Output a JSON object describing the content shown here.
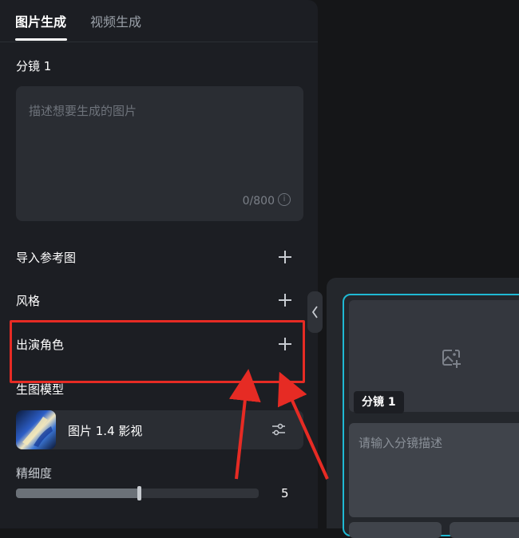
{
  "tabs": [
    {
      "label": "图片生成",
      "active": true
    },
    {
      "label": "视频生成",
      "active": false
    }
  ],
  "storyboard_title": "分镜 1",
  "prompt": {
    "placeholder": "描述想要生成的图片",
    "counter": "0/800"
  },
  "options": {
    "reference_image": "导入参考图",
    "style": "风格",
    "cast_role": "出演角色"
  },
  "model": {
    "section_label": "生图模型",
    "name": "图片 1.4 影视"
  },
  "precision": {
    "label": "精细度",
    "value": 5,
    "fill_fraction": 0.5
  },
  "frame_card": {
    "badge": "分镜 1",
    "description_placeholder": "请输入分镜描述"
  },
  "colors": {
    "highlight": "#e62b24",
    "accent": "#1fb9d3",
    "panel": "#1c1e23"
  }
}
